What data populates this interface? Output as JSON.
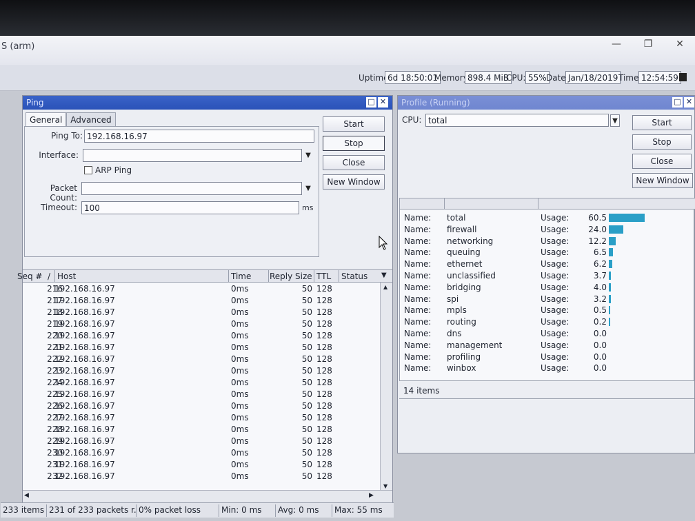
{
  "app": {
    "title": "S (arm)"
  },
  "status": {
    "uptime_label": "Uptime:",
    "uptime": "6d 18:50:01",
    "memory_label": "Memory:",
    "memory": "898.4 MiB",
    "cpu_label": "CPU:",
    "cpu": "55%",
    "date_label": "Date:",
    "date": "Jan/18/2019",
    "time_label": "Time:",
    "time": "12:54:59"
  },
  "ping": {
    "title": "Ping",
    "tabs": [
      "General",
      "Advanced"
    ],
    "ping_to_label": "Ping To:",
    "ping_to": "192.168.16.97",
    "interface_label": "Interface:",
    "interface": "",
    "arp_ping_label": "ARP Ping",
    "packet_count_label": "Packet Count:",
    "packet_count": "",
    "timeout_label": "Timeout:",
    "timeout": "100",
    "timeout_unit": "ms",
    "buttons": {
      "start": "Start",
      "stop": "Stop",
      "close": "Close",
      "new_window": "New Window"
    },
    "columns": {
      "seq": "Seq #",
      "sort": "/",
      "host": "Host",
      "time": "Time",
      "reply_size": "Reply Size",
      "ttl": "TTL",
      "status": "Status"
    },
    "rows": [
      {
        "seq": "216",
        "host": "192.168.16.97",
        "time": "0ms",
        "size": "50",
        "ttl": "128"
      },
      {
        "seq": "217",
        "host": "192.168.16.97",
        "time": "0ms",
        "size": "50",
        "ttl": "128"
      },
      {
        "seq": "218",
        "host": "192.168.16.97",
        "time": "0ms",
        "size": "50",
        "ttl": "128"
      },
      {
        "seq": "219",
        "host": "192.168.16.97",
        "time": "0ms",
        "size": "50",
        "ttl": "128"
      },
      {
        "seq": "220",
        "host": "192.168.16.97",
        "time": "0ms",
        "size": "50",
        "ttl": "128"
      },
      {
        "seq": "221",
        "host": "192.168.16.97",
        "time": "0ms",
        "size": "50",
        "ttl": "128"
      },
      {
        "seq": "222",
        "host": "192.168.16.97",
        "time": "0ms",
        "size": "50",
        "ttl": "128"
      },
      {
        "seq": "223",
        "host": "192.168.16.97",
        "time": "0ms",
        "size": "50",
        "ttl": "128"
      },
      {
        "seq": "224",
        "host": "192.168.16.97",
        "time": "0ms",
        "size": "50",
        "ttl": "128"
      },
      {
        "seq": "225",
        "host": "192.168.16.97",
        "time": "0ms",
        "size": "50",
        "ttl": "128"
      },
      {
        "seq": "226",
        "host": "192.168.16.97",
        "time": "0ms",
        "size": "50",
        "ttl": "128"
      },
      {
        "seq": "227",
        "host": "192.168.16.97",
        "time": "0ms",
        "size": "50",
        "ttl": "128"
      },
      {
        "seq": "228",
        "host": "192.168.16.97",
        "time": "0ms",
        "size": "50",
        "ttl": "128"
      },
      {
        "seq": "229",
        "host": "192.168.16.97",
        "time": "0ms",
        "size": "50",
        "ttl": "128"
      },
      {
        "seq": "230",
        "host": "192.168.16.97",
        "time": "0ms",
        "size": "50",
        "ttl": "128"
      },
      {
        "seq": "231",
        "host": "192.168.16.97",
        "time": "0ms",
        "size": "50",
        "ttl": "128"
      },
      {
        "seq": "232",
        "host": "192.168.16.97",
        "time": "0ms",
        "size": "50",
        "ttl": "128"
      }
    ],
    "footer": {
      "items": "233 items",
      "packets": "231 of 233 packets r...",
      "loss": "0% packet loss",
      "min": "Min: 0 ms",
      "avg": "Avg: 0 ms",
      "max": "Max: 55 ms"
    }
  },
  "profile": {
    "title": "Profile (Running)",
    "cpu_label": "CPU:",
    "cpu": "total",
    "buttons": {
      "start": "Start",
      "stop": "Stop",
      "close": "Close",
      "new_window": "New Window"
    },
    "name_label": "Name:",
    "usage_label": "Usage:",
    "rows": [
      {
        "name": "total",
        "usage": "60.5",
        "value": 60.5
      },
      {
        "name": "firewall",
        "usage": "24.0",
        "value": 24.0
      },
      {
        "name": "networking",
        "usage": "12.2",
        "value": 12.2
      },
      {
        "name": "queuing",
        "usage": "6.5",
        "value": 6.5
      },
      {
        "name": "ethernet",
        "usage": "6.2",
        "value": 6.2
      },
      {
        "name": "unclassified",
        "usage": "3.7",
        "value": 3.7
      },
      {
        "name": "bridging",
        "usage": "4.0",
        "value": 4.0
      },
      {
        "name": "spi",
        "usage": "3.2",
        "value": 3.2
      },
      {
        "name": "mpls",
        "usage": "0.5",
        "value": 0.5
      },
      {
        "name": "routing",
        "usage": "0.2",
        "value": 0.2
      },
      {
        "name": "dns",
        "usage": "0.0",
        "value": 0.0
      },
      {
        "name": "management",
        "usage": "0.0",
        "value": 0.0
      },
      {
        "name": "profiling",
        "usage": "0.0",
        "value": 0.0
      },
      {
        "name": "winbox",
        "usage": "0.0",
        "value": 0.0
      }
    ],
    "items": "14 items"
  },
  "colors": {
    "titlebar_blue": "#2a52b8",
    "usage_bar": "#2a9fc7"
  }
}
